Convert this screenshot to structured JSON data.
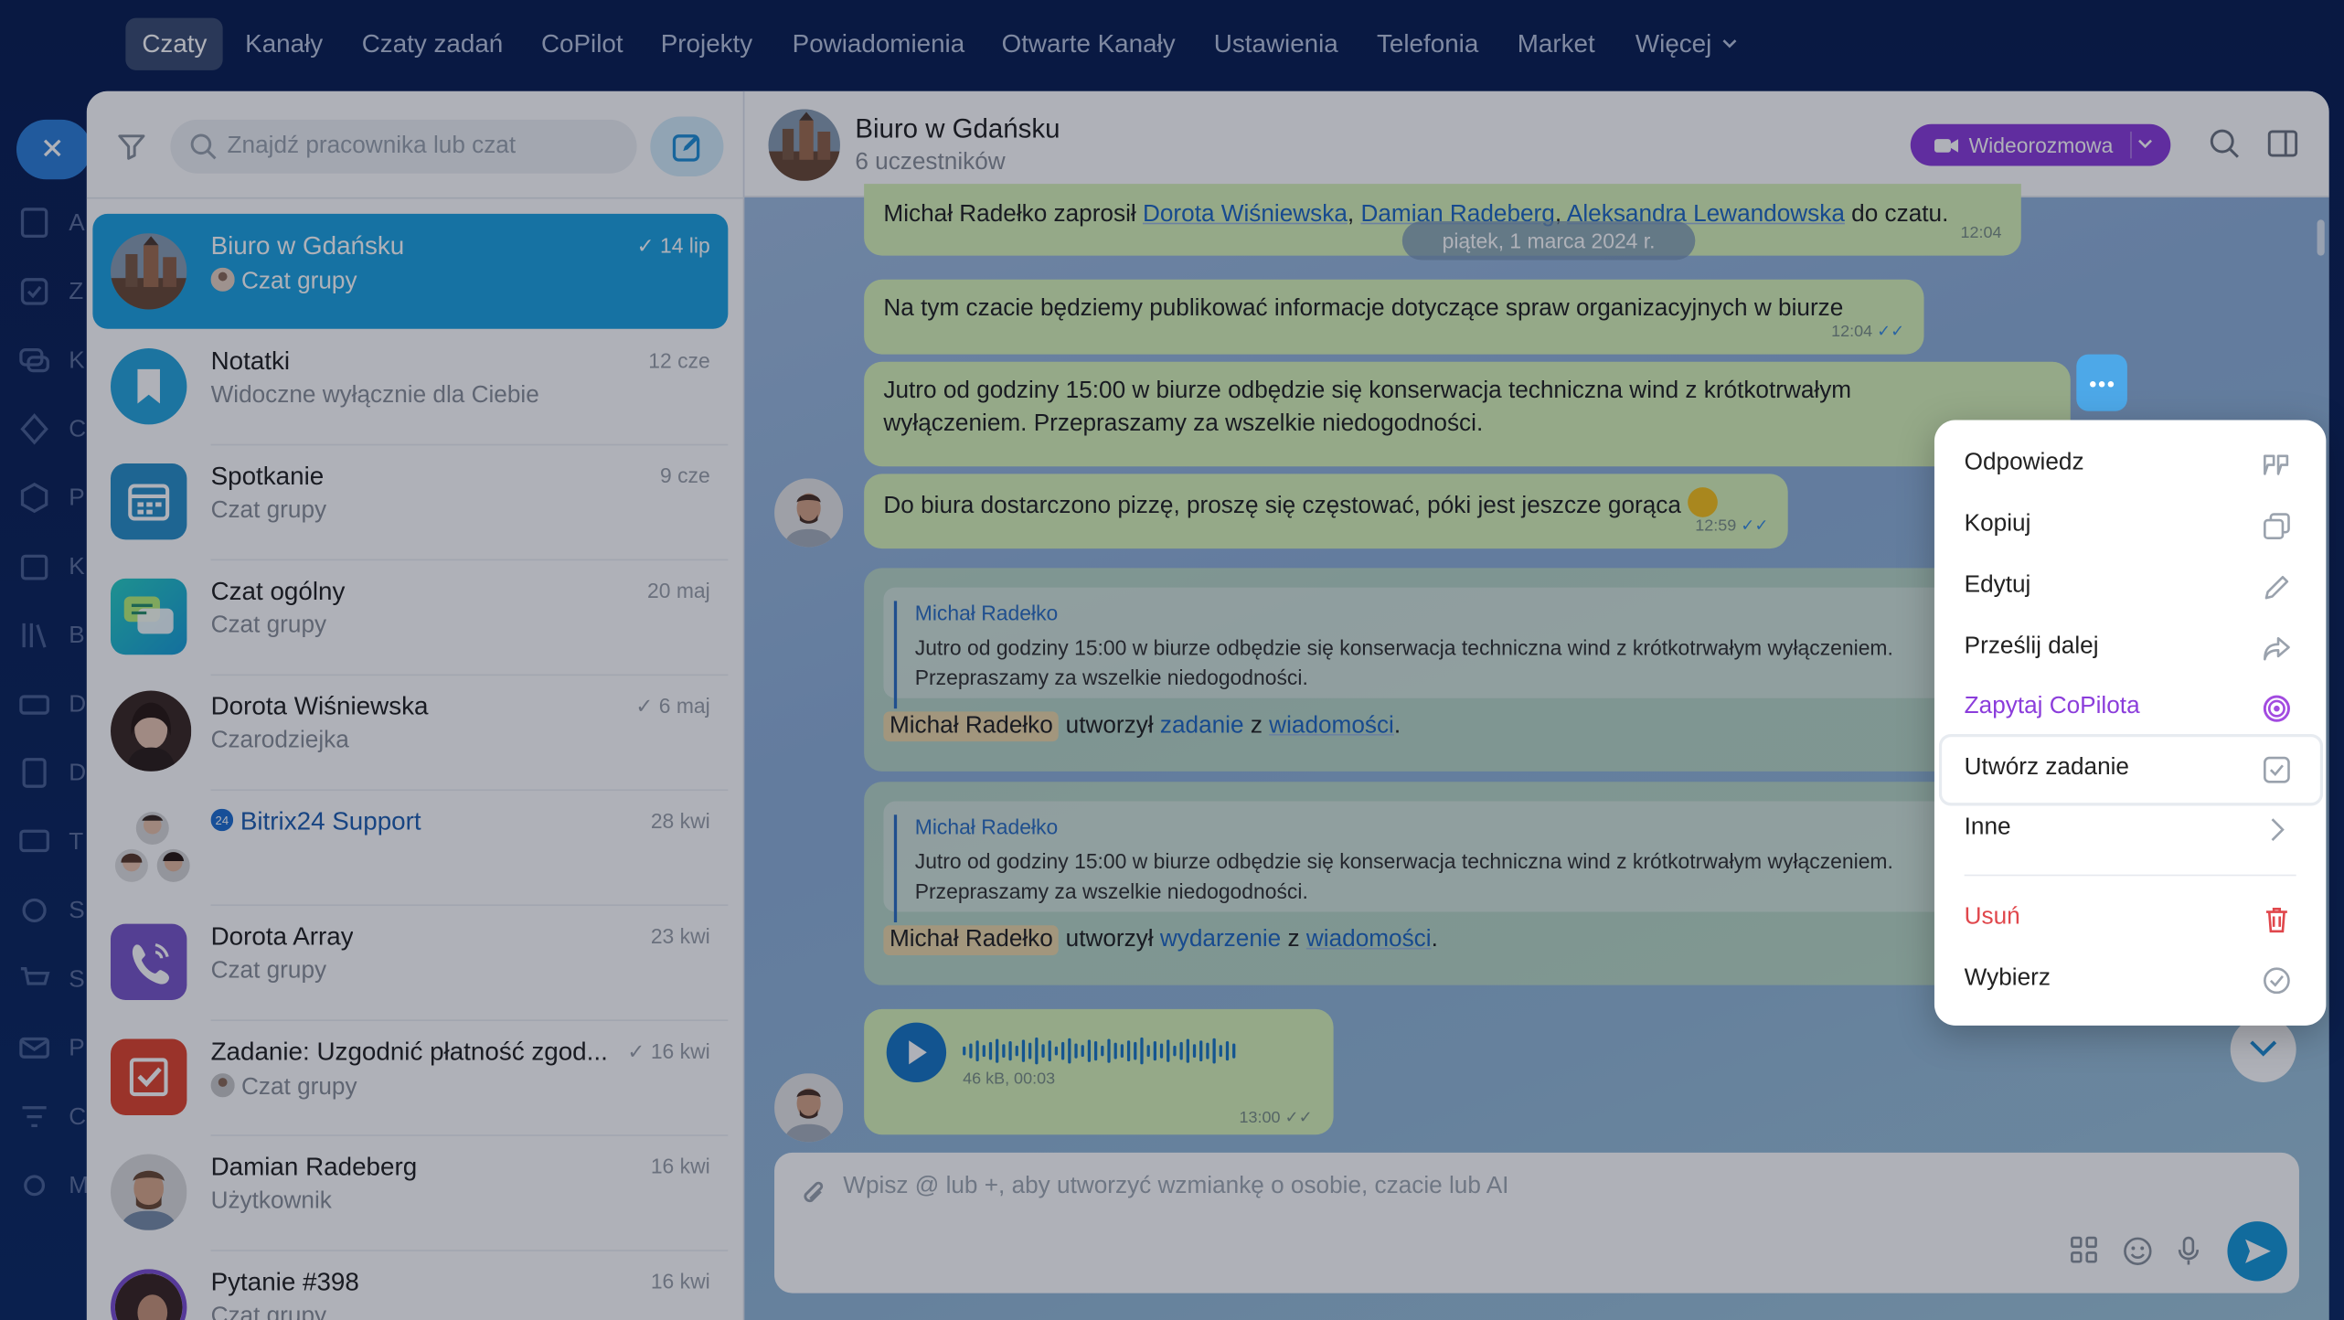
{
  "nav": {
    "items": [
      "Czaty",
      "Kanały",
      "Czaty zadań",
      "CoPilot",
      "Projekty",
      "Powiadomienia",
      "Otwarte Kanały",
      "Ustawienia",
      "Telefonia",
      "Market",
      "Więcej"
    ],
    "active": "Czaty"
  },
  "rail": {
    "letters": [
      "A",
      "Z",
      "K",
      "C",
      "P",
      "K",
      "B",
      "D",
      "D",
      "T",
      "S",
      "S",
      "P",
      "C",
      "M"
    ]
  },
  "sidebar": {
    "search_placeholder": "Znajdź pracownika lub czat",
    "chats": [
      {
        "name": "Biuro w Gdańsku",
        "sub": "Czat grupy",
        "date": "✓ 14 lip",
        "active": true
      },
      {
        "name": "Notatki",
        "sub": "Widoczne wyłącznie dla Ciebie",
        "date": "12 cze"
      },
      {
        "name": "Spotkanie",
        "sub": "Czat grupy",
        "date": "9 cze"
      },
      {
        "name": "Czat ogólny",
        "sub": "Czat grupy",
        "date": "20 maj"
      },
      {
        "name": "Dorota Wiśniewska",
        "sub": "Czarodziejka",
        "date": "✓ 6 maj"
      },
      {
        "name": "Bitrix24 Support",
        "sub": "",
        "date": "28 kwi"
      },
      {
        "name": "Dorota Array",
        "sub": "Czat grupy",
        "date": "23 kwi"
      },
      {
        "name": "Zadanie: Uzgodnić płatność zgod...",
        "sub": "Czat grupy",
        "date": "✓ 16 kwi"
      },
      {
        "name": "Damian Radeberg",
        "sub": "Użytkownik",
        "date": "16 kwi"
      },
      {
        "name": "Pytanie #398",
        "sub": "Czat grupy",
        "date": "16 kwi"
      }
    ]
  },
  "chat": {
    "title": "Biuro w Gdańsku",
    "members": "6 uczestników",
    "video_label": "Wideorozmowa",
    "date_divider": "piątek, 1 marca 2024 r.",
    "system": {
      "prefix": "Michał Radełko zaprosił",
      "u1": "Dorota Wiśniewska",
      "comma": ",",
      "u2": "Damian Radeberg",
      "u3": "Aleksandra Lewandowska",
      "suffix": "do czatu.",
      "time": "12:04"
    },
    "m1": {
      "text": "Na tym czacie będziemy publikować informacje dotyczące spraw organizacyjnych w biurze",
      "time": "12:04"
    },
    "m2": {
      "line1": "Jutro od godziny 15:00 w biurze odbędzie się konserwacja techniczna wind z krótkotrwałym",
      "line2": "wyłączeniem. Przepraszamy za wszelkie niedogodności."
    },
    "m3": {
      "text": "Do biura dostarczono pizzę, proszę się częstować, póki jest jeszcze gorąca",
      "time": "12:59"
    },
    "card1": {
      "quote_author": "Michał Radełko",
      "quote_line1": "Jutro od godziny 15:00 w biurze odbędzie się konserwacja techniczna wind z krótkotrwałym wyłączeniem.",
      "quote_line2": "Przepraszamy za wszelkie niedogodności.",
      "actor": "Michał Radełko",
      "verb": "utworzył",
      "object": "zadanie",
      "conj": "z",
      "source": "wiadomości",
      "dot": "."
    },
    "card2": {
      "quote_author": "Michał Radełko",
      "quote_line1": "Jutro od godziny 15:00 w biurze odbędzie się konserwacja techniczna wind z krótkotrwałym wyłączeniem.",
      "quote_line2": "Przepraszamy za wszelkie niedogodności.",
      "actor": "Michał Radełko",
      "verb": "utworzył",
      "object": "wydarzenie",
      "conj": "z",
      "source": "wiadomości",
      "dot": "."
    },
    "voice": {
      "meta": "46 kB, 00:03",
      "time": "13:00"
    },
    "input_placeholder": "Wpisz @ lub +, aby utworzyć wzmiankę o osobie, czacie lub AI"
  },
  "context_menu": {
    "items": [
      {
        "label": "Odpowiedz",
        "icon": "quote-icon"
      },
      {
        "label": "Kopiuj",
        "icon": "copy-icon"
      },
      {
        "label": "Edytuj",
        "icon": "pencil-icon"
      },
      {
        "label": "Prześlij dalej",
        "icon": "forward-icon"
      },
      {
        "label": "Zapytaj CoPilota",
        "icon": "copilot-icon"
      },
      {
        "label": "Utwórz zadanie",
        "icon": "task-checkbox-icon"
      },
      {
        "label": "Inne",
        "icon": "chevron-right-icon"
      },
      {
        "label": "Usuń",
        "icon": "trash-icon"
      },
      {
        "label": "Wybierz",
        "icon": "check-circle-icon"
      }
    ],
    "highlighted": "Utwórz zadanie"
  },
  "colors": {
    "accent": "#1ea3e0",
    "video": "#8b3ddb",
    "copilot": "#8b3ddb",
    "danger": "#e0474c",
    "bubble": "#d9f4b8",
    "link": "#1f67c2"
  }
}
